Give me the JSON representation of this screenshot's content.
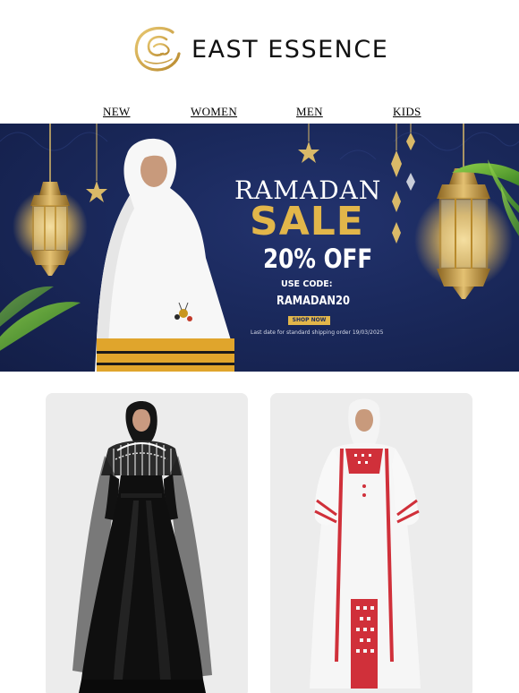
{
  "brand": {
    "name": "EAST ESSENCE",
    "logo_icon": "ornate-e-monogram-icon",
    "gold": "#c9a24a"
  },
  "nav": {
    "items": [
      {
        "label": "NEW"
      },
      {
        "label": "WOMEN"
      },
      {
        "label": "MEN"
      },
      {
        "label": "KIDS"
      }
    ]
  },
  "banner": {
    "headline": "RAMADAN",
    "sale": "SALE",
    "discount": "20% OFF",
    "use_code_label": "USE CODE:",
    "code": "RAMADAN20",
    "cta": "SHOP NOW",
    "note": "Last date for standard shipping order 19/03/2025",
    "colors": {
      "background": "#1b2a5e",
      "accent": "#e2b64a"
    },
    "decor_icons": [
      "hanging-lantern-icon",
      "hanging-star-icon",
      "palm-leaf-icon"
    ]
  },
  "products": [
    {
      "description_icon": "black-embellished-abaya-image"
    },
    {
      "description_icon": "white-embroidered-thobe-image"
    }
  ]
}
